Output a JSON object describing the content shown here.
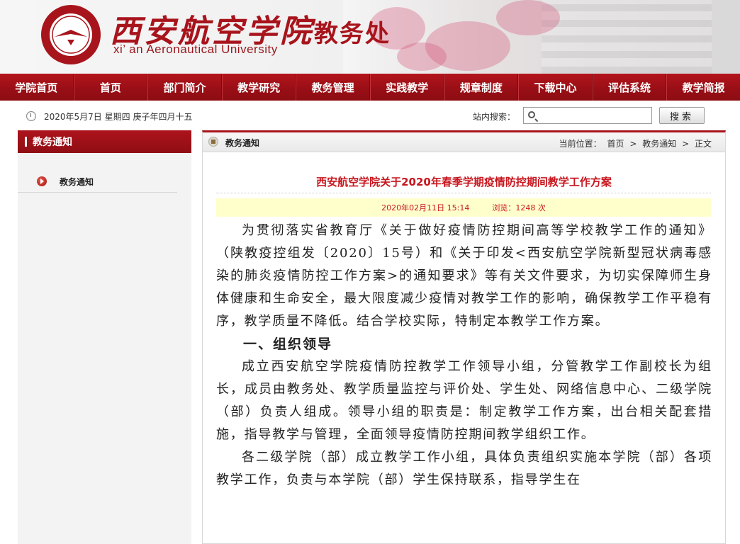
{
  "header": {
    "school_name_cn": "西安航空学院",
    "dept_name": "教务处",
    "school_name_en": "xi’ an Aeronautical University"
  },
  "nav": {
    "items": [
      "学院首页",
      "首页",
      "部门简介",
      "教学研究",
      "教务管理",
      "实践教学",
      "规章制度",
      "下载中心",
      "评估系统",
      "教学简报"
    ]
  },
  "infobar": {
    "date": "2020年5月7日   星期四   庚子年四月十五",
    "search_label": "站内搜索：",
    "search_placeholder": "",
    "search_button": "搜索"
  },
  "sidebar": {
    "title": "教务通知",
    "items": [
      {
        "label": "教务通知"
      }
    ]
  },
  "main": {
    "section_title": "教务通知",
    "breadcrumb": {
      "prefix": "当前位置：",
      "items": [
        "首页",
        "教务通知",
        "正文"
      ],
      "separator": ">"
    },
    "article": {
      "title": "西安航空学院关于2020年春季学期疫情防控期间教学工作方案",
      "date": "2020年02月11日 15:14",
      "views": "浏览：1248 次",
      "paragraphs": [
        "为贯彻落实省教育厅《关于做好疫情防控期间高等学校教学工作的通知》（陕教疫控组发〔2020〕15号）和《关于印发<西安航空学院新型冠状病毒感染的肺炎疫情防控工作方案>的通知要求》等有关文件要求，为切实保障师生身体健康和生命安全，最大限度减少疫情对教学工作的影响，确保教学工作平稳有序，教学质量不降低。结合学校实际，特制定本教学工作方案。",
        "一、组织领导",
        "成立西安航空学院疫情防控教学工作领导小组，分管教学工作副校长为组长，成员由教务处、教学质量监控与评价处、学生处、网络信息中心、二级学院（部）负责人组成。领导小组的职责是：制定教学工作方案，出台相关配套措施，指导教学与管理，全面领导疫情防控期间教学组织工作。",
        "各二级学院（部）成立教学工作小组，具体负责组织实施本学院（部）各项教学工作，负责与本学院（部）学生保持联系，指导学生在"
      ]
    }
  }
}
